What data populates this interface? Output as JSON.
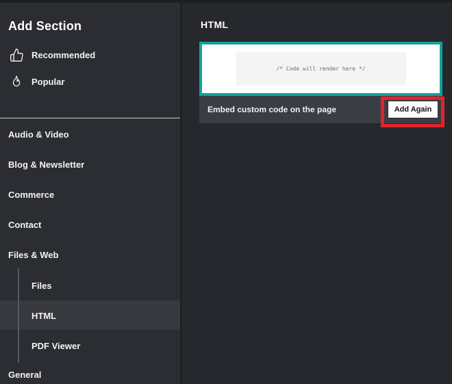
{
  "colors": {
    "accent_teal": "#14a39c",
    "annotation_red": "#e0242a"
  },
  "sidebar": {
    "title": "Add Section",
    "quick_links": [
      {
        "label": "Recommended",
        "icon": "thumbs-up-icon"
      },
      {
        "label": "Popular",
        "icon": "flame-icon"
      }
    ],
    "categories": [
      {
        "label": "Audio & Video"
      },
      {
        "label": "Blog & Newsletter"
      },
      {
        "label": "Commerce"
      },
      {
        "label": "Contact"
      },
      {
        "label": "Files & Web"
      },
      {
        "label": "General"
      }
    ],
    "files_web_children": [
      {
        "label": "Files",
        "active": false
      },
      {
        "label": "HTML",
        "active": true
      },
      {
        "label": "PDF Viewer",
        "active": false
      }
    ]
  },
  "main": {
    "title": "HTML",
    "preview_placeholder": "/* Code will render here */",
    "embed_description": "Embed custom code on the page",
    "add_again_label": "Add Again"
  }
}
